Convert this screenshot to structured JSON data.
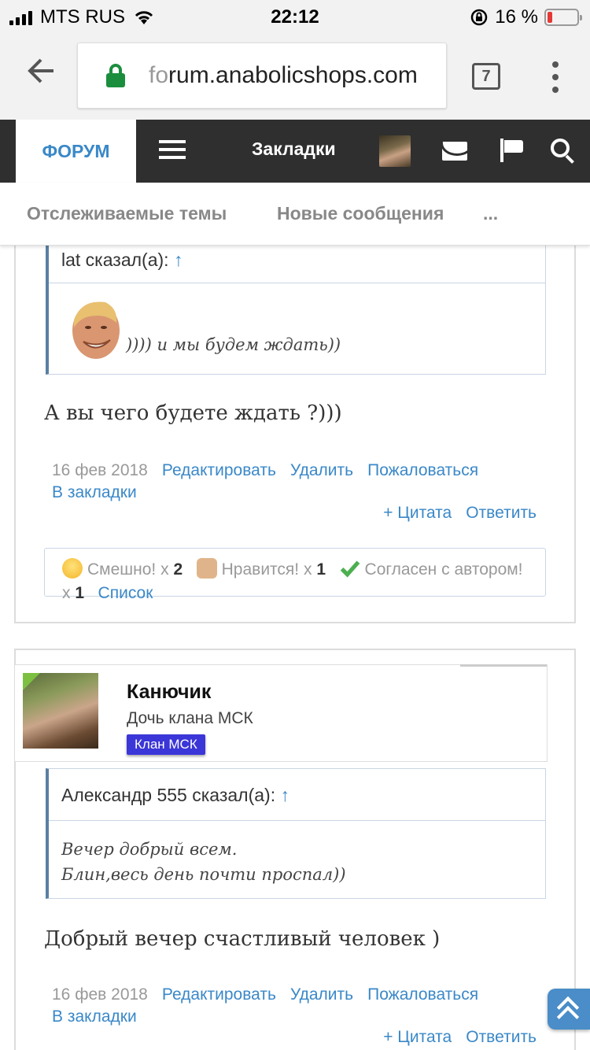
{
  "status_bar": {
    "carrier": "MTS RUS",
    "time": "22:12",
    "battery_percent": "16 %",
    "battery_level": 0.16
  },
  "browser": {
    "url_dim": "fo",
    "url_main": "rum.anabolicshops.com",
    "tab_count": "7"
  },
  "forum_nav": {
    "active_tab": "ФОРУМ",
    "bookmarks": "Закладки"
  },
  "sub_nav": {
    "items": [
      "Отслеживаемые темы",
      "Новые сообщения",
      "..."
    ]
  },
  "post1": {
    "quote_author": "lat сказал(а):",
    "quote_arrow": "↑",
    "quote_text": ")))) и мы будем ждать))",
    "message": "А вы чего будете ждать ?)))",
    "date": "16 фев 2018",
    "links": [
      "Редактировать",
      "Удалить",
      "Пожаловаться",
      "В закладки"
    ],
    "actions": [
      "+ Цитата",
      "Ответить"
    ],
    "reactions": {
      "funny_label": "Смешно!",
      "funny_count": "2",
      "like_label": "Нравится!",
      "like_count": "1",
      "agree_label": "Согласен с автором!",
      "agree_count": "1",
      "x": "x",
      "list": "Список"
    }
  },
  "post2": {
    "user_name": "Канючик",
    "user_title": "Дочь клана МСК",
    "user_badge": "Клан МСК",
    "quote_author": "Александр 555 сказал(а):",
    "quote_arrow": "↑",
    "quote_line1": "Вечер добрый всем.",
    "quote_line2": "Блин,весь день почти проспал))",
    "message": "Добрый вечер счастливый человек )",
    "date": "16 фев 2018",
    "links": [
      "Редактировать",
      "Удалить",
      "Пожаловаться",
      "В закладки"
    ],
    "actions": [
      "+ Цитата",
      "Ответить"
    ]
  },
  "colors": {
    "link": "#3a88c8",
    "nav_bg": "#2f2f2f",
    "badge": "#3b36d8",
    "quote_border": "#5b7fa3"
  },
  "icons": [
    "signal-icon",
    "wifi-icon",
    "lock-icon",
    "back-arrow-icon",
    "menu-dots-icon",
    "hamburger-icon",
    "envelope-icon",
    "flag-icon",
    "search-icon",
    "laugh-emoji-icon",
    "thumbs-up-icon",
    "checkmark-icon",
    "scroll-top-icon"
  ]
}
